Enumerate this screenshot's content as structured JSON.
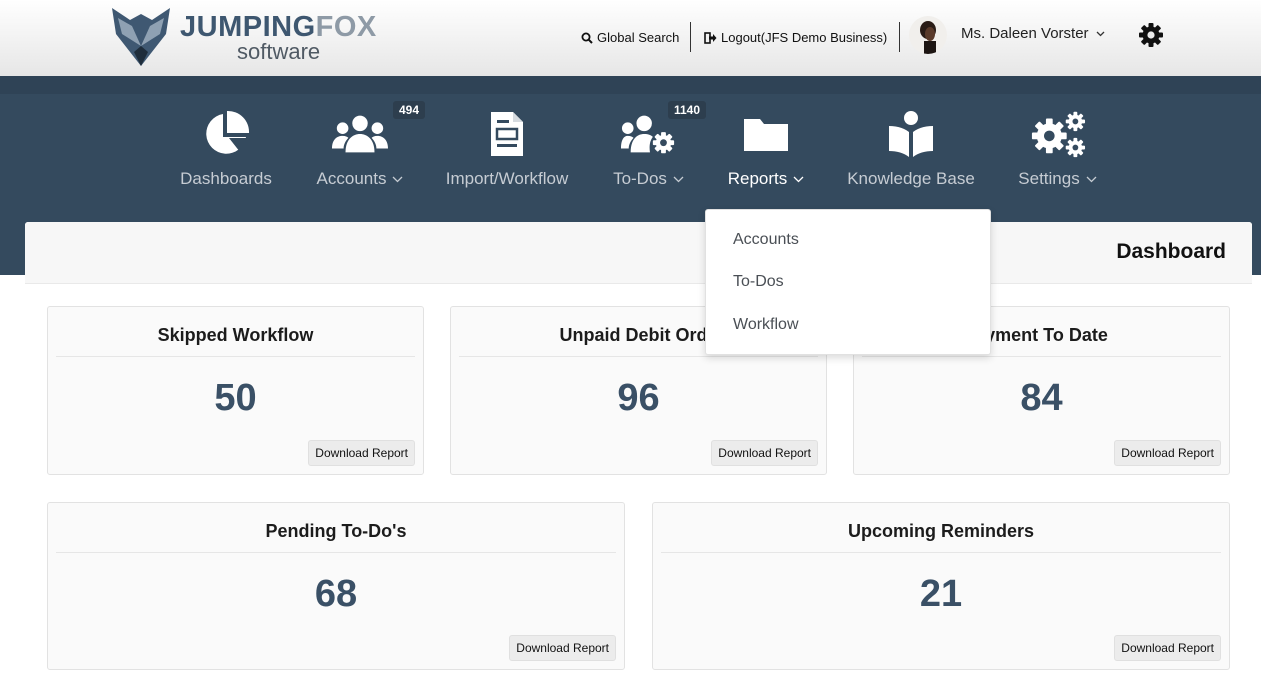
{
  "header": {
    "logo_word_1": "JUMPING",
    "logo_word_2": "FOX",
    "logo_sub": "software",
    "global_search_label": "Global Search",
    "logout_label": "Logout(JFS Demo Business)",
    "user_name": "Ms. Daleen Vorster"
  },
  "nav": {
    "items": [
      {
        "label": "Dashboards",
        "icon": "pie-chart-icon"
      },
      {
        "label": "Accounts",
        "icon": "users-icon",
        "badge": "494"
      },
      {
        "label": "Import/Workflow",
        "icon": "document-icon"
      },
      {
        "label": "To-Dos",
        "icon": "users-gear-icon",
        "badge": "1140"
      },
      {
        "label": "Reports",
        "icon": "folder-icon"
      },
      {
        "label": "Knowledge Base",
        "icon": "book-reader-icon"
      },
      {
        "label": "Settings",
        "icon": "gears-icon"
      }
    ]
  },
  "reports_menu": {
    "items": [
      "Accounts",
      "To-Dos",
      "Workflow"
    ]
  },
  "panel": {
    "title": "Dashboard"
  },
  "cards": [
    {
      "title": "Skipped Workflow",
      "value": "50",
      "button": "Download Report"
    },
    {
      "title": "Unpaid Debit Orde",
      "value": "96",
      "button": "Download Report"
    },
    {
      "title": "ayment To Date",
      "value": "84",
      "button": "Download Report"
    },
    {
      "title": "Pending To-Do's",
      "value": "68",
      "button": "Download Report"
    },
    {
      "title": "Upcoming Reminders",
      "value": "21",
      "button": "Download Report"
    }
  ],
  "colors": {
    "nav_bg": "#344a5e",
    "value_text": "#3a5066",
    "logo_blue": "#3e5770"
  }
}
